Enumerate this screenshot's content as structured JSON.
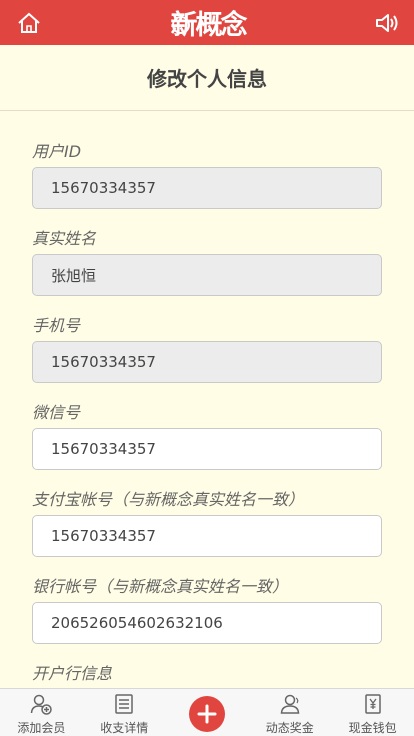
{
  "header": {
    "logo_text": "新概念",
    "page_title": "修改个人信息"
  },
  "fields": [
    {
      "label": "用户ID",
      "value": "15670334357",
      "readonly": true
    },
    {
      "label": "真实姓名",
      "value": "张旭恒",
      "readonly": true
    },
    {
      "label": "手机号",
      "value": "15670334357",
      "readonly": true
    },
    {
      "label": "微信号",
      "value": "15670334357",
      "readonly": false
    },
    {
      "label": "支付宝帐号（与新概念真实姓名一致）",
      "value": "15670334357",
      "readonly": false
    },
    {
      "label": "银行帐号（与新概念真实姓名一致）",
      "value": "206526054602632106",
      "readonly": false
    },
    {
      "label": "开户行信息",
      "value": "",
      "readonly": false
    }
  ],
  "nav": {
    "items": [
      {
        "label": "添加会员",
        "icon": "add-user-icon"
      },
      {
        "label": "收支详情",
        "icon": "list-icon"
      },
      {
        "label": "",
        "icon": "plus-icon"
      },
      {
        "label": "动态奖金",
        "icon": "users-icon"
      },
      {
        "label": "现金钱包",
        "icon": "wallet-icon"
      }
    ]
  },
  "colors": {
    "brand": "#e0463f",
    "background": "#fffde6"
  }
}
